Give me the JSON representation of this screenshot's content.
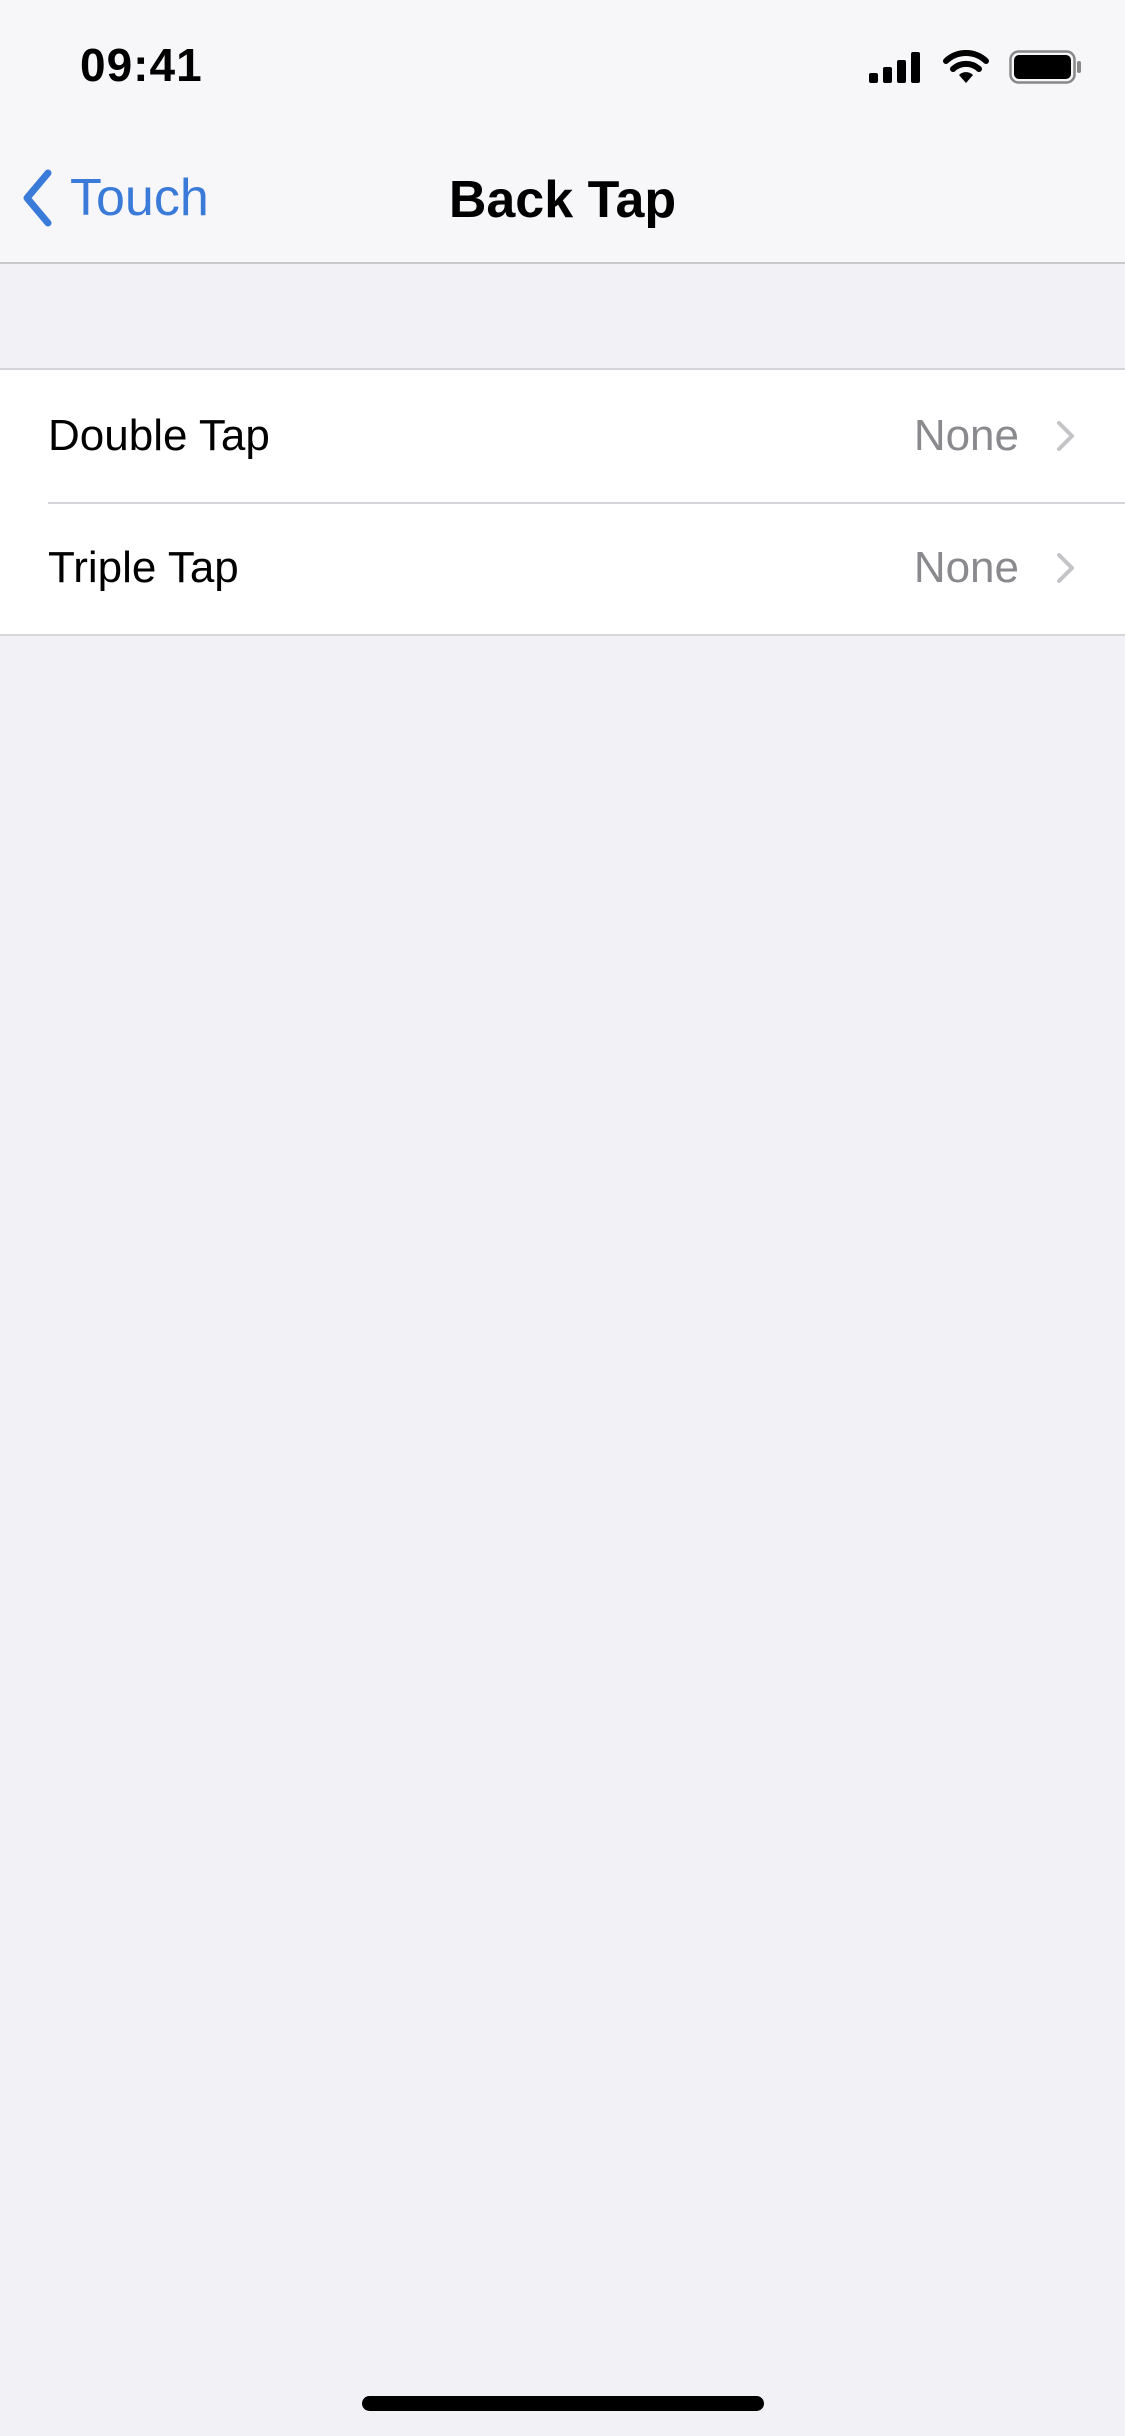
{
  "status_bar": {
    "time": "09:41",
    "icons": [
      "cellular-signal-icon",
      "wifi-icon",
      "battery-icon"
    ]
  },
  "nav": {
    "back_label": "Touch",
    "title": "Back Tap",
    "back_icon": "chevron-left-icon",
    "accent_color": "#3a7ad8"
  },
  "settings": {
    "rows": [
      {
        "label": "Double Tap",
        "value": "None",
        "icon": "chevron-right-icon"
      },
      {
        "label": "Triple Tap",
        "value": "None",
        "icon": "chevron-right-icon"
      }
    ]
  }
}
